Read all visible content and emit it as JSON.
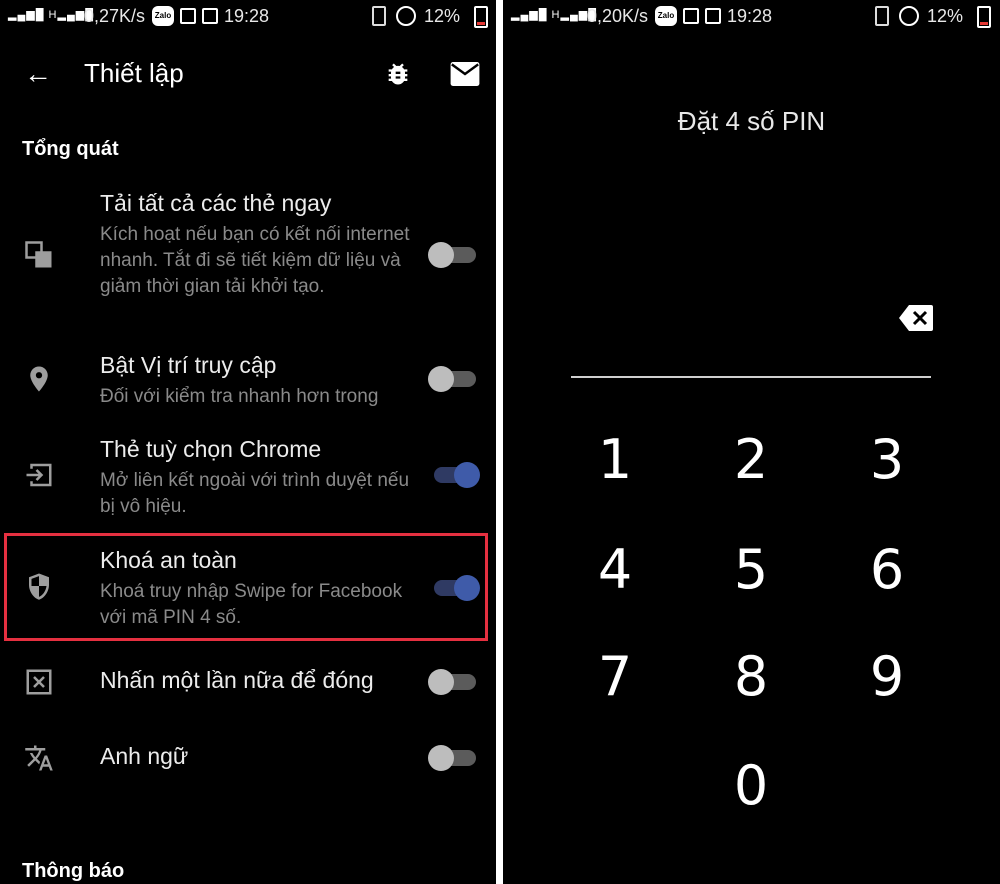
{
  "left": {
    "status": {
      "speed": "0,27K/s",
      "time": "19:28",
      "battery": "12%",
      "zalo": "Zalo"
    },
    "appbar": {
      "title": "Thiết lập"
    },
    "section_general": "Tổng quát",
    "settings": [
      {
        "title": "Tải tất cả các thẻ ngay",
        "desc": "Kích hoạt nếu bạn có kết nối internet nhanh. Tắt đi sẽ tiết kiệm dữ liệu và giảm thời gian tải khởi tạo.",
        "on": false
      },
      {
        "title": "Bật Vị trí truy cập",
        "desc": "Đối với kiểm tra nhanh hơn trong",
        "on": false
      },
      {
        "title": "Thẻ tuỳ chọn Chrome",
        "desc": "Mở liên kết ngoài với trình duyệt nếu bị vô hiệu.",
        "on": true
      },
      {
        "title": "Khoá an toàn",
        "desc": "Khoá truy nhập Swipe for Facebook với mã PIN 4 số.",
        "on": true
      },
      {
        "title": "Nhấn một lần nữa để đóng",
        "desc": "",
        "on": false
      },
      {
        "title": "Anh ngữ",
        "desc": "",
        "on": false
      }
    ],
    "section_notifications": "Thông báo"
  },
  "right": {
    "status": {
      "speed": "0,20K/s",
      "time": "19:28",
      "battery": "12%",
      "zalo": "Zalo"
    },
    "pin_title": "Đặt 4 số PIN",
    "keys": [
      "1",
      "2",
      "3",
      "4",
      "5",
      "6",
      "7",
      "8",
      "9",
      "0"
    ]
  },
  "colors": {
    "accent": "#3f5ba9",
    "highlight": "#e53040",
    "background": "#000000"
  }
}
